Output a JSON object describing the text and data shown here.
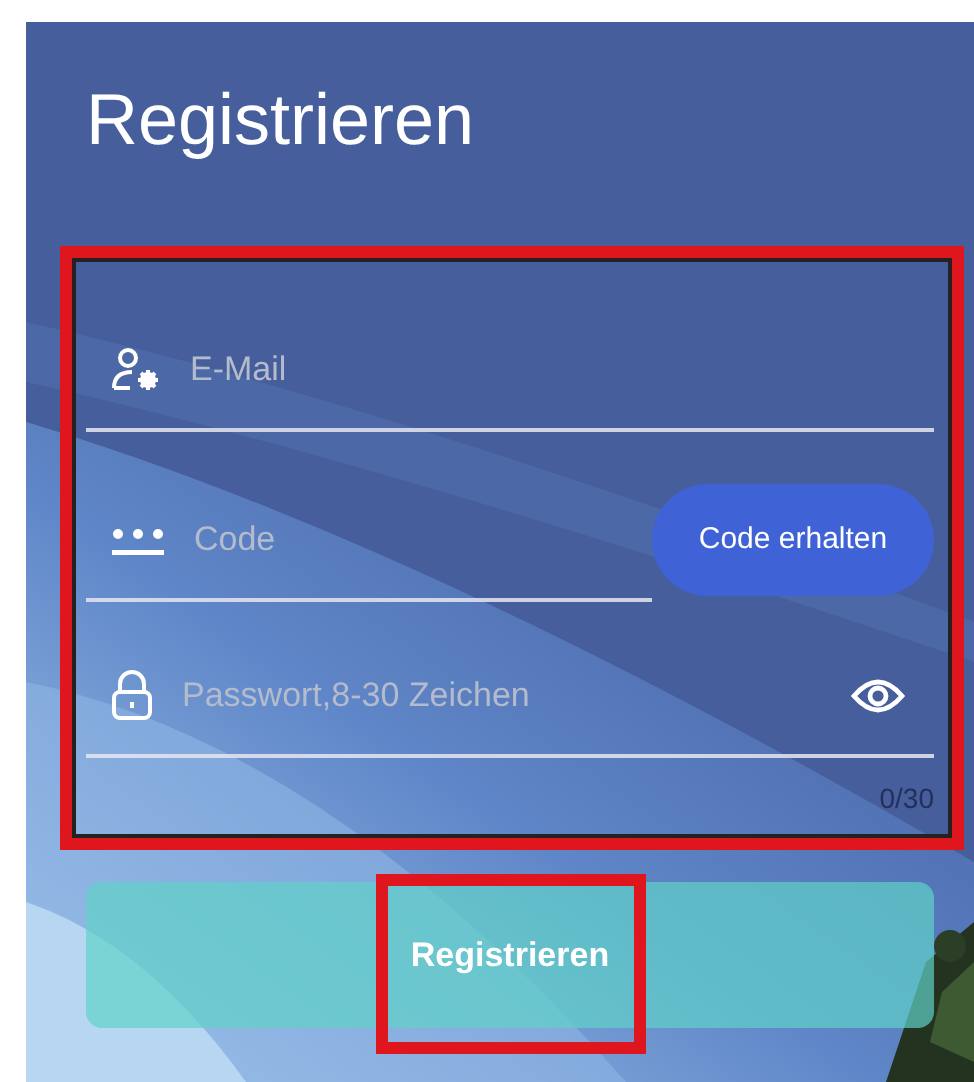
{
  "title": "Registrieren",
  "form": {
    "highlighted": true,
    "fields": [
      {
        "kind": "email",
        "placeholder": "E-Mail"
      },
      {
        "kind": "code",
        "placeholder": "Code",
        "action": "Code erhalten"
      },
      {
        "kind": "password",
        "placeholder": "Passwort,8-30 Zeichen",
        "counter": "0/30"
      }
    ]
  },
  "submit": {
    "label": "Registrieren",
    "highlighted": true
  }
}
